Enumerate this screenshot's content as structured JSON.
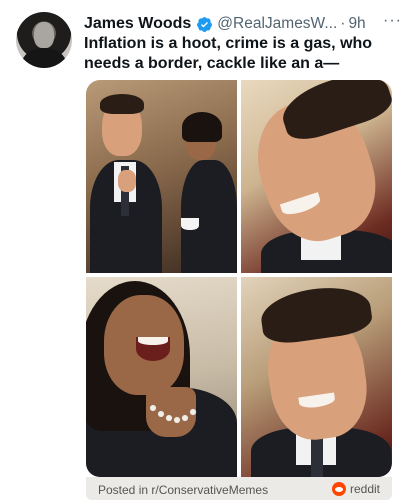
{
  "tweet": {
    "author_name": "James Woods",
    "handle": "@RealJamesW...",
    "separator": "·",
    "time": "9h",
    "more_label": "···",
    "text": "Inflation is a hoot, crime is a gas, who needs a border, cackle like an a—",
    "verified_color": "#1d9bf0"
  },
  "media": {
    "image_count": 4
  },
  "footer": {
    "posted_in": "Posted in r/ConservativeMemes",
    "source": "reddit",
    "source_color": "#ff4500"
  }
}
